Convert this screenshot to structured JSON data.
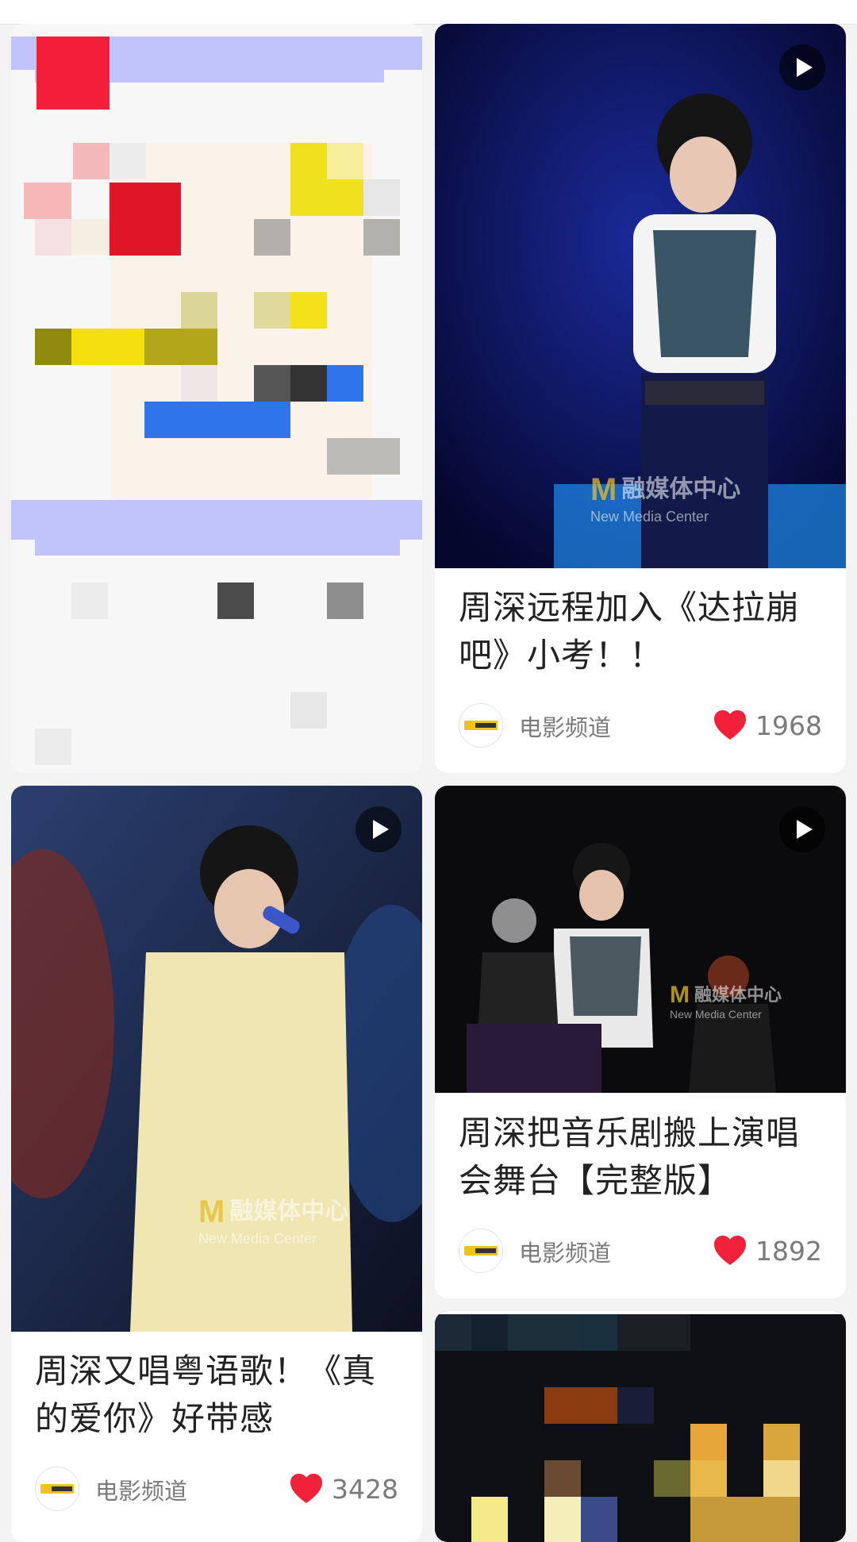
{
  "cards": [
    {
      "title": "",
      "has_play": false,
      "blurred": true
    },
    {
      "title": "周深远程加入《达拉崩吧》小考！！",
      "channel": "电影频道",
      "likes": "1968",
      "has_play": true,
      "watermark": {
        "cn": "融媒体中心",
        "en": "New Media Center"
      }
    },
    {
      "title": "周深又唱粤语歌！《真的爱你》好带感",
      "channel": "电影频道",
      "likes": "3428",
      "has_play": true,
      "watermark": {
        "cn": "融媒体中心",
        "en": "New Media Center"
      }
    },
    {
      "title": "周深把音乐剧搬上演唱会舞台【完整版】",
      "channel": "电影频道",
      "likes": "1892",
      "has_play": true,
      "watermark": {
        "cn": "融媒体中心",
        "en": "New Media Center"
      }
    },
    {
      "title": "",
      "has_play": false,
      "blurred": true
    }
  ],
  "colors": {
    "heart": "#f2213a",
    "background": "#f3f3f3",
    "card": "#ffffff"
  },
  "icons": [
    "play-icon",
    "heart-icon",
    "channel-avatar"
  ]
}
